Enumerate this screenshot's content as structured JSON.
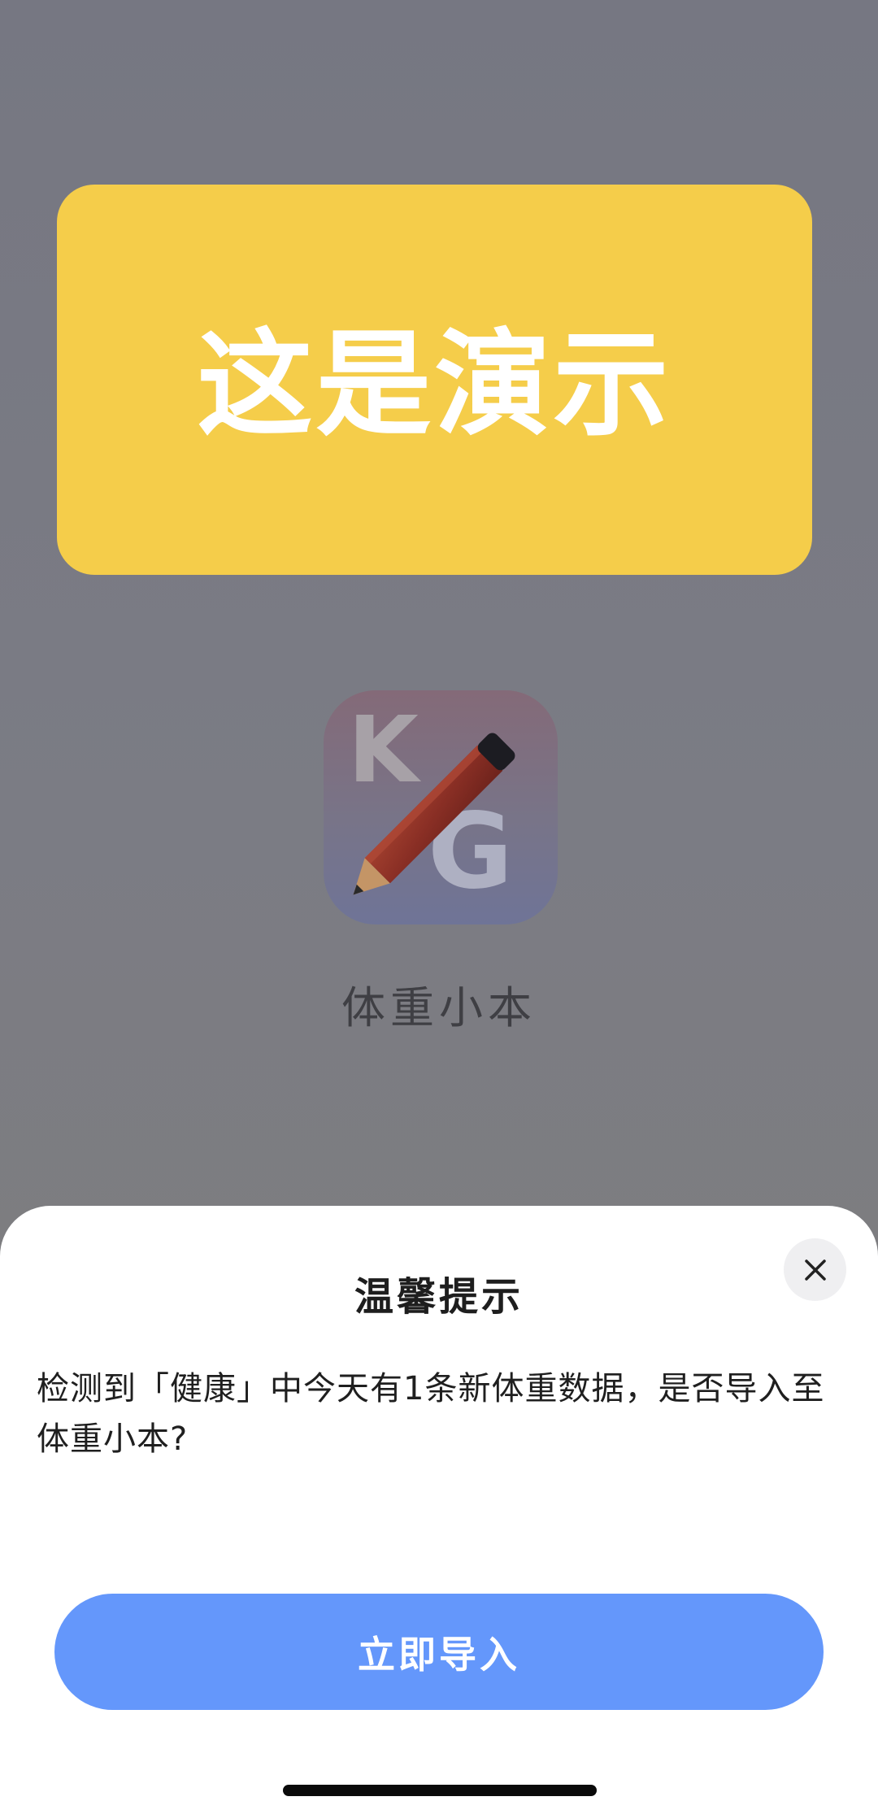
{
  "banner": {
    "text": "这是演示"
  },
  "app": {
    "icon_letters": [
      "K",
      "G"
    ],
    "name": "体重小本"
  },
  "dialog": {
    "title": "温馨提示",
    "message": "检测到「健康」中今天有1条新体重数据，是否导入至体重小本?",
    "primary_button": "立即导入"
  },
  "colors": {
    "banner": "#f5cd4a",
    "button": "#6497fb",
    "sheet": "#ffffff",
    "overlay": "#7e7e86"
  }
}
